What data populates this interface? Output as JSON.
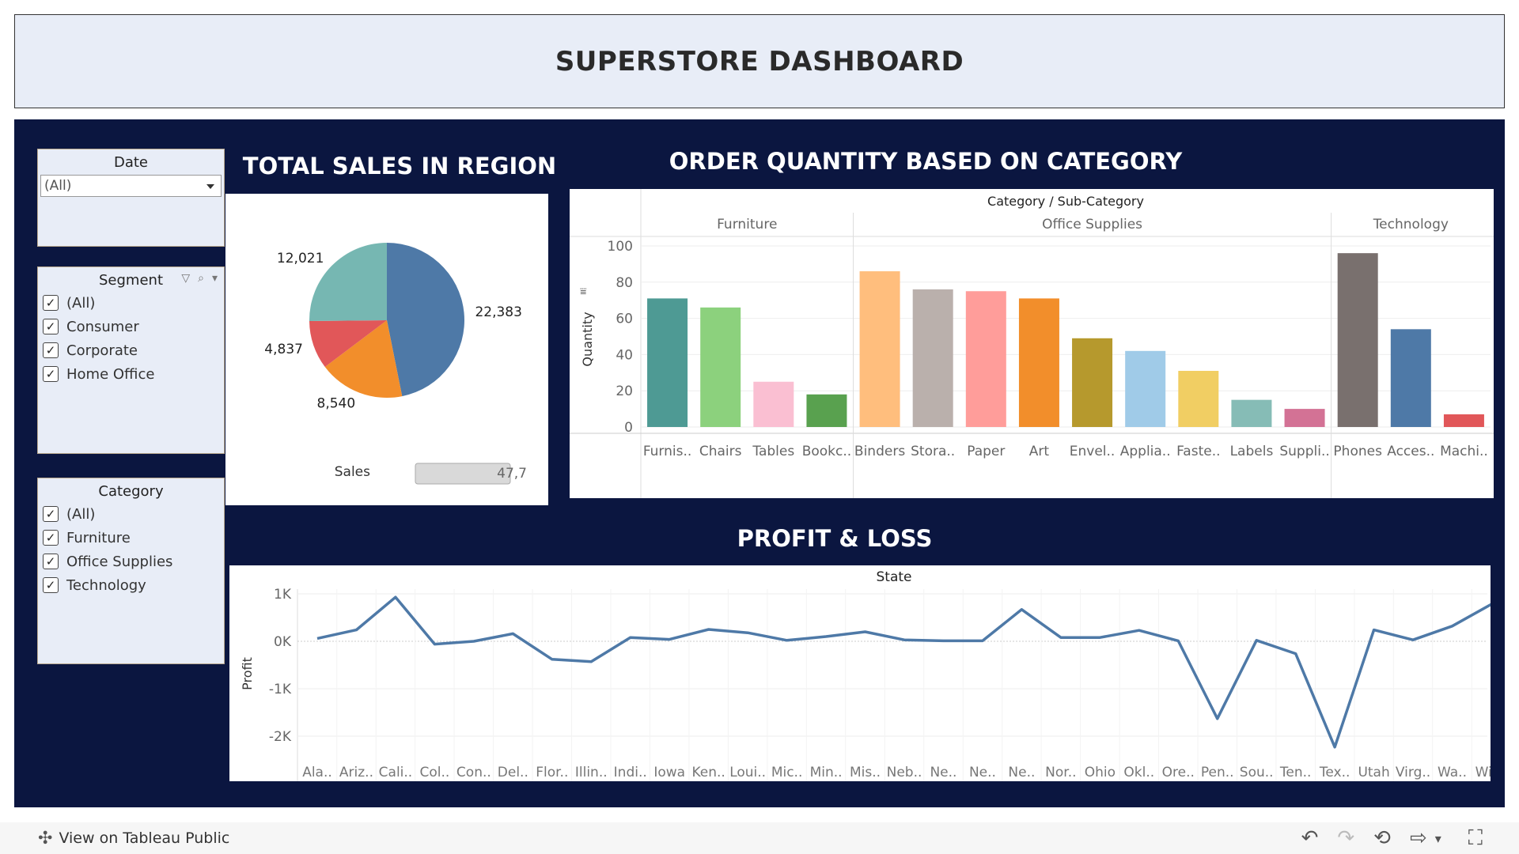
{
  "header": {
    "title": "SUPERSTORE DASHBOARD"
  },
  "filters": {
    "date": {
      "title": "Date",
      "value": "(All)"
    },
    "segment": {
      "title": "Segment",
      "items": [
        "(All)",
        "Consumer",
        "Corporate",
        "Home Office"
      ]
    },
    "category": {
      "title": "Category",
      "items": [
        "(All)",
        "Furniture",
        "Office Supplies",
        "Technology"
      ]
    }
  },
  "sections": {
    "sales_title": "TOTAL SALES IN REGION",
    "quantity_title": "ORDER QUANTITY BASED ON CATEGORY",
    "profit_title": "PROFIT & LOSS"
  },
  "sales_legend": {
    "label": "Sales",
    "value": "47,7"
  },
  "chart_data": [
    {
      "type": "pie",
      "title": "TOTAL SALES IN REGION",
      "slices": [
        {
          "value": 22383,
          "label": "22,383",
          "color": "#4e79a7"
        },
        {
          "value": 8540,
          "label": "8,540",
          "color": "#f28e2b"
        },
        {
          "value": 4837,
          "label": "4,837",
          "color": "#e15759"
        },
        {
          "value": 12021,
          "label": "12,021",
          "color": "#76b7b2"
        }
      ]
    },
    {
      "type": "bar",
      "title": "ORDER QUANTITY BASED ON CATEGORY",
      "header": "Category / Sub-Category",
      "ylabel": "Quantity",
      "ylim": [
        0,
        100
      ],
      "yticks": [
        0,
        20,
        40,
        60,
        80,
        100
      ],
      "groups": [
        {
          "name": "Furniture",
          "bars": [
            {
              "label": "Furnis..",
              "value": 71,
              "color": "#4e9a94"
            },
            {
              "label": "Chairs",
              "value": 66,
              "color": "#8cd17d"
            },
            {
              "label": "Tables",
              "value": 25,
              "color": "#fabfd2"
            },
            {
              "label": "Bookc..",
              "value": 18,
              "color": "#59a14f"
            }
          ]
        },
        {
          "name": "Office Supplies",
          "bars": [
            {
              "label": "Binders",
              "value": 86,
              "color": "#ffbe7d"
            },
            {
              "label": "Stora..",
              "value": 76,
              "color": "#bab0ac"
            },
            {
              "label": "Paper",
              "value": 75,
              "color": "#ff9d9a"
            },
            {
              "label": "Art",
              "value": 71,
              "color": "#f28e2b"
            },
            {
              "label": "Envel..",
              "value": 49,
              "color": "#b6992d"
            },
            {
              "label": "Applia..",
              "value": 42,
              "color": "#a0cbe8"
            },
            {
              "label": "Faste..",
              "value": 31,
              "color": "#f1ce63"
            },
            {
              "label": "Labels",
              "value": 15,
              "color": "#86bcb6"
            },
            {
              "label": "Suppli..",
              "value": 10,
              "color": "#d37295"
            }
          ]
        },
        {
          "name": "Technology",
          "bars": [
            {
              "label": "Phones",
              "value": 96,
              "color": "#79706e"
            },
            {
              "label": "Acces..",
              "value": 54,
              "color": "#4e79a7"
            },
            {
              "label": "Machi..",
              "value": 7,
              "color": "#e15759"
            }
          ]
        }
      ]
    },
    {
      "type": "line",
      "title": "PROFIT & LOSS",
      "header": "State",
      "ylabel": "Profit",
      "yticks": [
        {
          "value": 1000,
          "label": "1K"
        },
        {
          "value": 0,
          "label": "0K"
        },
        {
          "value": -1000,
          "label": "-1K"
        },
        {
          "value": -2000,
          "label": "-2K"
        }
      ],
      "ylim": [
        -2450,
        1100
      ],
      "color": "#4e79a7",
      "x": [
        "Ala..",
        "Ariz..",
        "Cali..",
        "Col..",
        "Con..",
        "Del..",
        "Flor..",
        "Illin..",
        "Indi..",
        "Iowa",
        "Ken..",
        "Loui..",
        "Mic..",
        "Min..",
        "Mis..",
        "Neb..",
        "Ne..",
        "Ne..",
        "Ne..",
        "Nor..",
        "Ohio",
        "Okl..",
        "Ore..",
        "Pen..",
        "Sou..",
        "Ten..",
        "Tex..",
        "Utah",
        "Virg..",
        "Wa..",
        "Wis.."
      ],
      "y": [
        60,
        240,
        930,
        -60,
        0,
        160,
        -380,
        -430,
        80,
        40,
        250,
        180,
        20,
        100,
        200,
        30,
        10,
        10,
        670,
        80,
        80,
        230,
        10,
        -1630,
        20,
        -260,
        -2230,
        240,
        30,
        320,
        780
      ]
    }
  ],
  "footer": {
    "link_label": "View on Tableau Public",
    "icons": [
      "move-icon",
      "undo-icon",
      "redo-icon",
      "revert-icon",
      "share-icon",
      "dropdown-icon",
      "fullscreen-icon"
    ]
  }
}
